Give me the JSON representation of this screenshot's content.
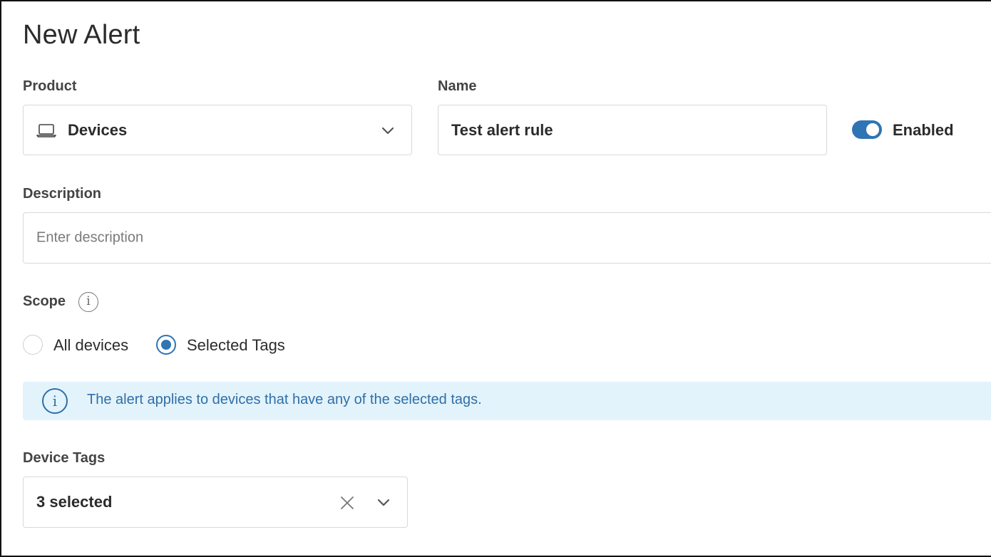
{
  "page": {
    "title": "New Alert"
  },
  "product": {
    "label": "Product",
    "value": "Devices",
    "icon": "laptop-icon"
  },
  "name": {
    "label": "Name",
    "value": "Test alert rule"
  },
  "enabled": {
    "label": "Enabled",
    "on": true,
    "color": "#2f74b5"
  },
  "description": {
    "label": "Description",
    "placeholder": "Enter description",
    "value": ""
  },
  "scope": {
    "label": "Scope",
    "options": [
      {
        "label": "All devices",
        "selected": false
      },
      {
        "label": "Selected Tags",
        "selected": true
      }
    ]
  },
  "banner": {
    "text": "The alert applies to devices that have any of the selected tags.",
    "background": "#e3f3fb",
    "color": "#2f6fa7"
  },
  "device_tags": {
    "label": "Device Tags",
    "value": "3 selected"
  }
}
